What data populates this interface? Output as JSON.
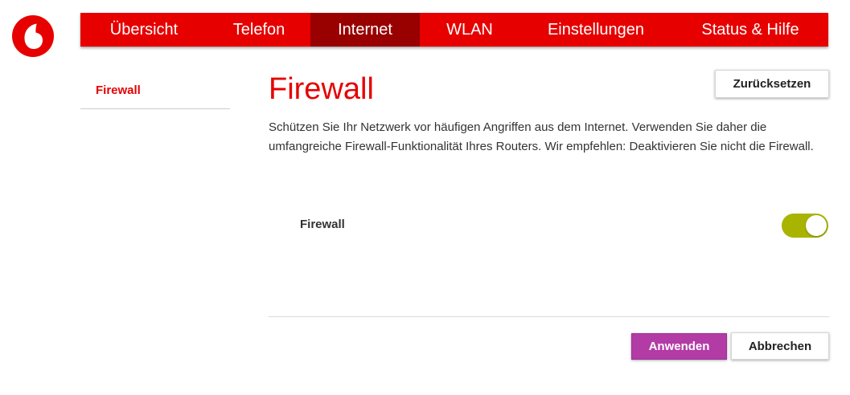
{
  "brand": {
    "logo": "vodafone-logo",
    "color": "#e60000"
  },
  "nav": {
    "items": [
      {
        "label": "Übersicht"
      },
      {
        "label": "Telefon"
      },
      {
        "label": "Internet"
      },
      {
        "label": "WLAN"
      },
      {
        "label": "Einstellungen"
      },
      {
        "label": "Status & Hilfe"
      }
    ],
    "active": "Internet",
    "bar_color": "#e60000",
    "active_color": "#990000"
  },
  "sidebar": {
    "items": [
      {
        "label": "Firewall",
        "selected": true
      }
    ]
  },
  "main": {
    "title": "Firewall",
    "reset_label": "Zurücksetzen",
    "description": "Schützen Sie Ihr Netzwerk vor häufigen Angriffen aus dem Internet. Verwenden Sie daher die umfangreiche Firewall-Funktionalität Ihres Routers. Wir empfehlen: Deaktivieren Sie nicht die Firewall.",
    "firewall_toggle": {
      "label": "Firewall",
      "enabled": true,
      "on_color": "#a8b400"
    },
    "apply_label": "Anwenden",
    "apply_color": "#b33ba6",
    "cancel_label": "Abbrechen"
  }
}
